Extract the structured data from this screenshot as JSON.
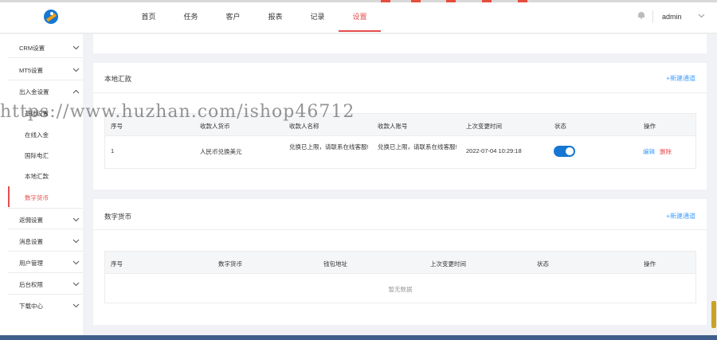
{
  "header": {
    "nav": [
      "首页",
      "任务",
      "客户",
      "报表",
      "记录",
      "设置"
    ],
    "active_nav": "设置",
    "user": "admin"
  },
  "sidebar": {
    "groups": [
      {
        "label": "CRM设置",
        "expanded": false
      },
      {
        "label": "MT5设置",
        "expanded": false
      },
      {
        "label": "出入金设置",
        "expanded": true
      },
      {
        "label": "返佣设置",
        "expanded": false
      },
      {
        "label": "消息设置",
        "expanded": false
      },
      {
        "label": "用户管理",
        "expanded": false
      },
      {
        "label": "后台权限",
        "expanded": false
      },
      {
        "label": "下载中心",
        "expanded": false
      }
    ],
    "subitems": [
      "基础设置",
      "在线入金",
      "国际电汇",
      "本地汇款",
      "数字货币"
    ],
    "active_subitem": "数字货币"
  },
  "local_transfer": {
    "title": "本地汇款",
    "add_label": "+新建通道",
    "columns": [
      "序号",
      "收款人货币",
      "收款人名称",
      "收款人账号",
      "上次变更时间",
      "状态",
      "操作"
    ],
    "rows": [
      {
        "index": "1",
        "currency": "人民币兑换美元",
        "name": "兑换已上限，请联系在线客服!",
        "account": "兑换已上限，请联系在线客服!",
        "updated": "2022-07-04 10:29:18",
        "enabled": true,
        "edit": "编辑",
        "delete": "删除"
      }
    ]
  },
  "crypto": {
    "title": "数字货币",
    "add_label": "+新建通道",
    "columns": [
      "序号",
      "数字货币",
      "钱包地址",
      "上次变更时间",
      "状态",
      "操作"
    ],
    "empty_text": "暂无数据"
  },
  "watermark": "https://www.huzhan.com/ishop46712",
  "colors": {
    "accent": "#e44d4d",
    "link": "#409eff",
    "toggle": "#1677d2"
  }
}
